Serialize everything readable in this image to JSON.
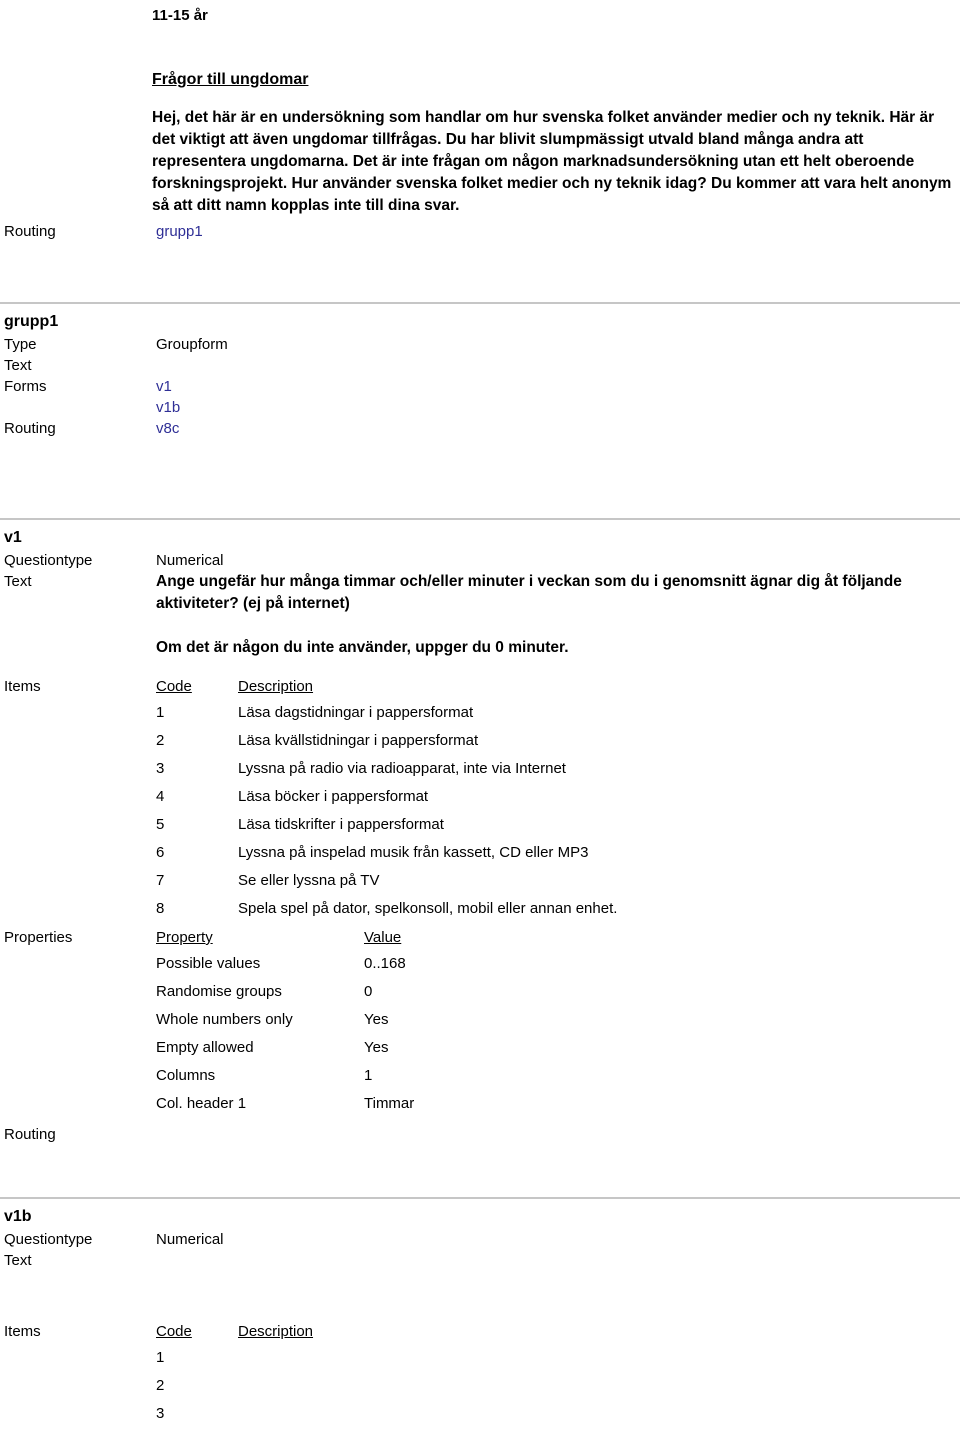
{
  "intro": {
    "age_heading": "11-15 år",
    "section_title": "Frågor till ungdomar",
    "paragraph": "Hej, det här är en undersökning som handlar om hur svenska folket använder medier och ny teknik. Här är det viktigt att även ungdomar tillfrågas. Du har blivit slumpmässigt utvald bland många andra att representera ungdomarna. Det är inte frågan om någon marknadsundersökning utan ett helt oberoende forskningsprojekt. Hur använder svenska folket medier och ny teknik idag? Du kommer att vara helt anonym så att ditt namn kopplas inte till dina svar.",
    "routing_label": "Routing",
    "routing_link": "grupp1"
  },
  "grupp1": {
    "title": "grupp1",
    "type_label": "Type",
    "type_value": "Groupform",
    "text_label": "Text",
    "text_value": "",
    "forms_label": "Forms",
    "forms_links": [
      "v1",
      "v1b"
    ],
    "routing_label": "Routing",
    "routing_link": "v8c"
  },
  "v1": {
    "title": "v1",
    "questiontype_label": "Questiontype",
    "questiontype_value": "Numerical",
    "text_label": "Text",
    "text_value": "Ange ungefär hur många timmar och/eller minuter i veckan som du i genomsnitt ägnar dig åt följande aktiviteter? (ej på internet)",
    "text_value2": "Om det är någon du inte använder, uppger du 0 minuter.",
    "items_label": "Items",
    "items_headers": [
      "Code",
      "Description"
    ],
    "items": [
      {
        "code": "1",
        "description": "Läsa dagstidningar i pappersformat"
      },
      {
        "code": "2",
        "description": "Läsa kvällstidningar i pappersformat"
      },
      {
        "code": "3",
        "description": "Lyssna på radio via radioapparat, inte via Internet"
      },
      {
        "code": "4",
        "description": "Läsa böcker i pappersformat"
      },
      {
        "code": "5",
        "description": "Läsa tidskrifter i pappersformat"
      },
      {
        "code": "6",
        "description": "Lyssna på inspelad musik från kassett, CD eller MP3"
      },
      {
        "code": "7",
        "description": "Se eller lyssna på TV"
      },
      {
        "code": "8",
        "description": "Spela spel på dator, spelkonsoll, mobil eller annan enhet."
      }
    ],
    "properties_label": "Properties",
    "properties_headers": [
      "Property",
      "Value"
    ],
    "properties": [
      {
        "property": "Possible values",
        "value": "0..168"
      },
      {
        "property": "Randomise groups",
        "value": "0"
      },
      {
        "property": "Whole numbers only",
        "value": "Yes"
      },
      {
        "property": "Empty allowed",
        "value": "Yes"
      },
      {
        "property": "Columns",
        "value": "1"
      },
      {
        "property": "Col. header 1",
        "value": "Timmar"
      }
    ],
    "routing_label": "Routing",
    "routing_value": ""
  },
  "v1b": {
    "title": "v1b",
    "questiontype_label": "Questiontype",
    "questiontype_value": "Numerical",
    "text_label": "Text",
    "text_value": "",
    "items_label": "Items",
    "items_headers": [
      "Code",
      "Description"
    ],
    "items": [
      {
        "code": "1",
        "description": ""
      },
      {
        "code": "2",
        "description": ""
      },
      {
        "code": "3",
        "description": ""
      }
    ]
  },
  "colors": {
    "link": "#2f2f96",
    "divider": "#c6c6c6",
    "text": "#000000",
    "background": "#ffffff"
  }
}
